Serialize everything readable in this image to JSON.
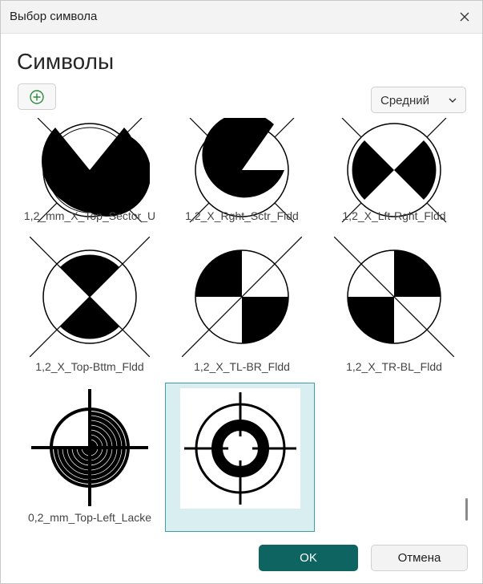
{
  "window": {
    "title": "Выбор символа"
  },
  "heading": "Символы",
  "toolbar": {
    "add_icon": "plus-circle-icon",
    "size_select_value": "Средний"
  },
  "symbols": [
    {
      "label": "1,2_mm_X_Top_Sector_U"
    },
    {
      "label": "1,2_X_Rght_Sctr_Fldd"
    },
    {
      "label": "1,2_X_Lft-Rght_Fldd"
    },
    {
      "label": "1,2_X_Top-Bttm_Fldd"
    },
    {
      "label": "1,2_X_TL-BR_Fldd"
    },
    {
      "label": "1,2_X_TR-BL_Fldd"
    },
    {
      "label": "0,2_mm_Top-Left_Lacke"
    },
    {
      "label": ""
    }
  ],
  "selected_index": 7,
  "footer": {
    "ok_label": "OK",
    "cancel_label": "Отмена"
  },
  "colors": {
    "primary": "#0d6460",
    "selection_bg": "#d8eef0",
    "selection_border": "#3aa0a6",
    "add_icon": "#2e8b3e"
  }
}
